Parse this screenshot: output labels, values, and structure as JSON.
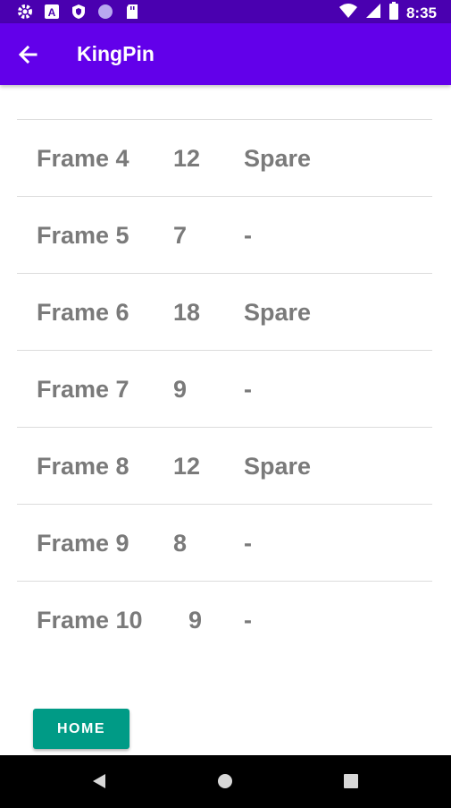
{
  "status_bar": {
    "time": "8:35",
    "left_icons": [
      "gear-icon",
      "a-badge-icon",
      "shield-icon",
      "circle-icon",
      "sd-card-icon"
    ],
    "right_icons": [
      "wifi-icon",
      "signal-icon",
      "battery-icon"
    ]
  },
  "app_bar": {
    "title": "KingPin",
    "background": "#6200ea",
    "status_background": "#4a00b0"
  },
  "frames": [
    {
      "frame": "Frame 4",
      "score": "12",
      "mark": "Spare"
    },
    {
      "frame": "Frame 5",
      "score": "7",
      "mark": "-"
    },
    {
      "frame": "Frame 6",
      "score": "18",
      "mark": "Spare"
    },
    {
      "frame": "Frame 7",
      "score": "9",
      "mark": "-"
    },
    {
      "frame": "Frame 8",
      "score": "12",
      "mark": "Spare"
    },
    {
      "frame": "Frame 9",
      "score": "8",
      "mark": "-"
    },
    {
      "frame": "Frame 10",
      "score": "9",
      "mark": "-"
    }
  ],
  "home_button": {
    "label": "HOME",
    "color": "#009b86"
  },
  "nav_bar": {
    "buttons": [
      "back-triangle-icon",
      "home-circle-icon",
      "recents-square-icon"
    ]
  }
}
